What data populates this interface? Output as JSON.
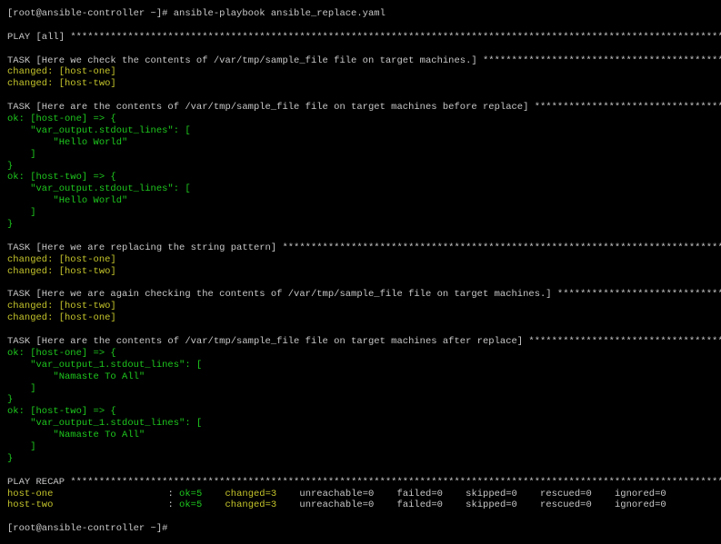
{
  "terminal": {
    "colors": {
      "text": "#c8c8c8",
      "ok": "#1ec81e",
      "changed": "#c4c42c",
      "background": "#000000"
    },
    "lines": [
      [
        {
          "t": "[root@ansible-controller ~]# ansible-playbook ansible_replace.yaml",
          "c": "w"
        }
      ],
      [],
      [
        {
          "t": "PLAY [all] ",
          "c": "w"
        },
        {
          "t": "stars",
          "c": "w"
        }
      ],
      [],
      [
        {
          "t": "TASK [Here we check the contents of /var/tmp/sample_file file on target machines.] ",
          "c": "w"
        },
        {
          "t": "stars",
          "c": "w"
        }
      ],
      [
        {
          "t": "changed: [host-one]",
          "c": "y"
        }
      ],
      [
        {
          "t": "changed: [host-two]",
          "c": "y"
        }
      ],
      [],
      [
        {
          "t": "TASK [Here are the contents of /var/tmp/sample_file file on target machines before replace] ",
          "c": "w"
        },
        {
          "t": "stars",
          "c": "w"
        }
      ],
      [
        {
          "t": "ok: [host-one] => {",
          "c": "g"
        }
      ],
      [
        {
          "t": "    \"var_output.stdout_lines\": [",
          "c": "g"
        }
      ],
      [
        {
          "t": "        \"Hello World\"",
          "c": "g"
        }
      ],
      [
        {
          "t": "    ]",
          "c": "g"
        }
      ],
      [
        {
          "t": "}",
          "c": "g"
        }
      ],
      [
        {
          "t": "ok: [host-two] => {",
          "c": "g"
        }
      ],
      [
        {
          "t": "    \"var_output.stdout_lines\": [",
          "c": "g"
        }
      ],
      [
        {
          "t": "        \"Hello World\"",
          "c": "g"
        }
      ],
      [
        {
          "t": "    ]",
          "c": "g"
        }
      ],
      [
        {
          "t": "}",
          "c": "g"
        }
      ],
      [],
      [
        {
          "t": "TASK [Here we are replacing the string pattern] ",
          "c": "w"
        },
        {
          "t": "stars",
          "c": "w"
        }
      ],
      [
        {
          "t": "changed: [host-one]",
          "c": "y"
        }
      ],
      [
        {
          "t": "changed: [host-two]",
          "c": "y"
        }
      ],
      [],
      [
        {
          "t": "TASK [Here we are again checking the contents of /var/tmp/sample_file file on target machines.] ",
          "c": "w"
        },
        {
          "t": "stars",
          "c": "w"
        }
      ],
      [
        {
          "t": "changed: [host-two]",
          "c": "y"
        }
      ],
      [
        {
          "t": "changed: [host-one]",
          "c": "y"
        }
      ],
      [],
      [
        {
          "t": "TASK [Here are the contents of /var/tmp/sample_file file on target machines after replace] ",
          "c": "w"
        },
        {
          "t": "stars",
          "c": "w"
        }
      ],
      [
        {
          "t": "ok: [host-one] => {",
          "c": "g"
        }
      ],
      [
        {
          "t": "    \"var_output_1.stdout_lines\": [",
          "c": "g"
        }
      ],
      [
        {
          "t": "        \"Namaste To All\"",
          "c": "g"
        }
      ],
      [
        {
          "t": "    ]",
          "c": "g"
        }
      ],
      [
        {
          "t": "}",
          "c": "g"
        }
      ],
      [
        {
          "t": "ok: [host-two] => {",
          "c": "g"
        }
      ],
      [
        {
          "t": "    \"var_output_1.stdout_lines\": [",
          "c": "g"
        }
      ],
      [
        {
          "t": "        \"Namaste To All\"",
          "c": "g"
        }
      ],
      [
        {
          "t": "    ]",
          "c": "g"
        }
      ],
      [
        {
          "t": "}",
          "c": "g"
        }
      ],
      [],
      [
        {
          "t": "PLAY RECAP ",
          "c": "w"
        },
        {
          "t": "stars",
          "c": "w"
        }
      ],
      [
        {
          "t": "host-one",
          "c": "y"
        },
        {
          "t": "                    : ",
          "c": "w"
        },
        {
          "t": "ok=5",
          "c": "g"
        },
        {
          "t": "    ",
          "c": "w"
        },
        {
          "t": "changed=3",
          "c": "y"
        },
        {
          "t": "    unreachable=0    failed=0    skipped=0    rescued=0    ignored=0",
          "c": "w"
        }
      ],
      [
        {
          "t": "host-two",
          "c": "y"
        },
        {
          "t": "                    : ",
          "c": "w"
        },
        {
          "t": "ok=5",
          "c": "g"
        },
        {
          "t": "    ",
          "c": "w"
        },
        {
          "t": "changed=3",
          "c": "y"
        },
        {
          "t": "    unreachable=0    failed=0    skipped=0    rescued=0    ignored=0",
          "c": "w"
        }
      ],
      [],
      [
        {
          "t": "[root@ansible-controller ~]#",
          "c": "w"
        }
      ]
    ]
  }
}
